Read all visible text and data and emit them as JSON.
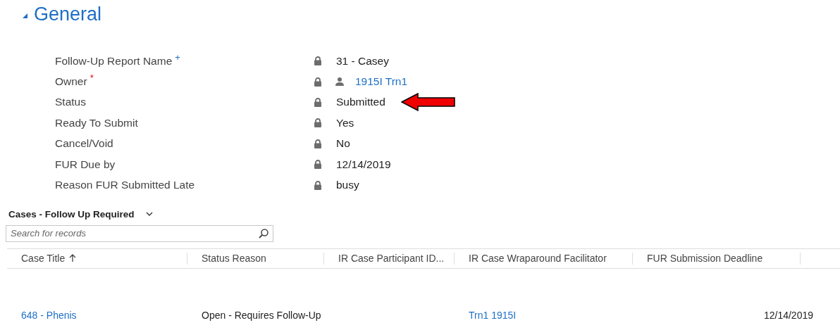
{
  "section": {
    "title": "General",
    "expanded": true
  },
  "fields": [
    {
      "label": "Follow-Up Report Name",
      "marker": {
        "kind": "recommended",
        "text": "+"
      },
      "value": "31 - Casey",
      "kind": "text",
      "locked": true
    },
    {
      "label": "Owner",
      "marker": {
        "kind": "required",
        "text": "*"
      },
      "value": "1915I Trn1",
      "kind": "user",
      "locked": true
    },
    {
      "label": "Status",
      "value": "Submitted",
      "kind": "text",
      "locked": true,
      "pointed": true
    },
    {
      "label": "Ready To Submit",
      "value": "Yes",
      "kind": "text",
      "locked": true
    },
    {
      "label": "Cancel/Void",
      "value": "No",
      "kind": "text",
      "locked": true
    },
    {
      "label": "FUR Due by",
      "value": "12/14/2019",
      "kind": "text",
      "locked": true
    },
    {
      "label": "Reason FUR Submitted Late",
      "value": "busy",
      "kind": "text",
      "locked": true
    }
  ],
  "grid": {
    "title": "Cases - Follow Up Required",
    "search": {
      "placeholder": "Search for records"
    },
    "columns": [
      {
        "label": "Case Title",
        "sorted": true
      },
      {
        "label": "Status Reason",
        "sorted": false
      },
      {
        "label": "IR Case Participant ID...",
        "sorted": false
      },
      {
        "label": "IR Case Wraparound Facilitator",
        "sorted": false
      },
      {
        "label": "FUR Submission Deadline",
        "sorted": false
      }
    ],
    "rows": [
      {
        "cells": [
          {
            "text": "648 - Phenis",
            "kind": "link"
          },
          {
            "text": "Open - Requires Follow-Up",
            "kind": "text"
          },
          {
            "text": "",
            "kind": "empty"
          },
          {
            "text": "Trn1 1915I",
            "kind": "link"
          },
          {
            "text": "12/14/2019",
            "kind": "date"
          }
        ]
      }
    ]
  }
}
